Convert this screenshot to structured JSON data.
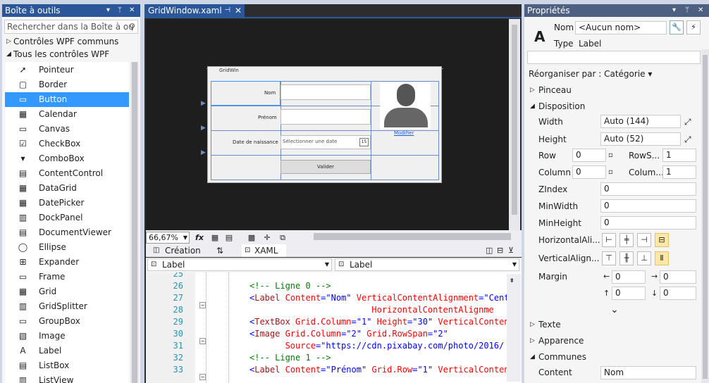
{
  "toolbox": {
    "title": "Boîte à outils",
    "search_placeholder": "Rechercher dans la Boîte à ou",
    "cat_common": "Contrôles WPF communs",
    "cat_all": "Tous les contrôles WPF",
    "items": [
      "Pointeur",
      "Border",
      "Button",
      "Calendar",
      "Canvas",
      "CheckBox",
      "ComboBox",
      "ContentControl",
      "DataGrid",
      "DatePicker",
      "DockPanel",
      "DocumentViewer",
      "Ellipse",
      "Expander",
      "Frame",
      "Grid",
      "GridSplitter",
      "GroupBox",
      "Image",
      "Label",
      "ListBox",
      "ListView"
    ],
    "selected": "Button"
  },
  "editor": {
    "tab_label": "GridWindow.xaml",
    "window_title": "GridWin",
    "col_widths": [
      "3*",
      "4*",
      "3*"
    ],
    "form": {
      "nom_label": "Nom",
      "prenom_label": "Prénom",
      "date_label": "Date de naissance",
      "date_placeholder": "Sélectionner une date",
      "calendar_day": "15",
      "modifier_link": "Modifier",
      "valider_button": "Valider"
    },
    "zoom": "66,67%",
    "fx_label": "fx",
    "creation_tab": "Création",
    "swap_icon": "⇅",
    "xaml_tab": "XAML",
    "left_combo": "Label",
    "right_combo": "Label",
    "code_lines": [
      {
        "n": "25",
        "html": ""
      },
      {
        "n": "26",
        "html": "<span class='cm'>&lt;!-- Ligne 0 --&gt;</span>"
      },
      {
        "n": "27",
        "html": "<span class='vl'>&lt;</span><span class='tg'>Label</span> <span class='at'>Content</span><span class='vl'>=\"Nom\"</span> <span class='at'>VerticalContentAlignment</span><span class='vl'>=\"Cente</span>"
      },
      {
        "n": "28",
        "html": "                        <span class='at'>HorizontalContentAlignme</span>"
      },
      {
        "n": "29",
        "html": "<span class='vl'>&lt;</span><span class='tg'>TextBox</span> <span class='at'>Grid.Column</span><span class='vl'>=\"1\"</span> <span class='at'>Height</span><span class='vl'>=\"30\"</span> <span class='at'>VerticalContent</span>"
      },
      {
        "n": "30",
        "html": "<span class='vl'>&lt;</span><span class='tg'>Image</span> <span class='at'>Grid.Column</span><span class='vl'>=\"2\"</span> <span class='at'>Grid.RowSpan</span><span class='vl'>=\"2\"</span>"
      },
      {
        "n": "31",
        "html": "       <span class='at'>Source</span><span class='vl'>=\"https://cdn.pixabay.com/photo/2016/</span>"
      },
      {
        "n": "32",
        "html": "<span class='cm'>&lt;!-- Ligne 1 --&gt;</span>"
      },
      {
        "n": "33",
        "html": "<span class='vl'>&lt;</span><span class='tg'>Label</span> <span class='at'>Content</span><span class='vl'>=\"Prénom\"</span> <span class='at'>Grid.Row</span><span class='vl'>=\"1\"</span> <span class='at'>VerticalContent</span>"
      }
    ]
  },
  "properties": {
    "title": "Propriétés",
    "name_label": "Nom",
    "name_value": "<Aucun nom>",
    "type_label": "Type",
    "type_value": "Label",
    "arrange_by": "Réorganiser par : Catégorie",
    "sections": {
      "pinceau": "Pinceau",
      "disposition": "Disposition",
      "texte": "Texte",
      "apparence": "Apparence",
      "communes": "Communes"
    },
    "width_label": "Width",
    "width_value": "Auto (144)",
    "height_label": "Height",
    "height_value": "Auto (52)",
    "row_label": "Row",
    "row_value": "0",
    "rowspan_label": "RowS...",
    "rowspan_value": "1",
    "column_label": "Column",
    "column_value": "0",
    "colspan_label": "Colum...",
    "colspan_value": "1",
    "zindex_label": "ZIndex",
    "zindex_value": "0",
    "minwidth_label": "MinWidth",
    "minwidth_value": "0",
    "minheight_label": "MinHeight",
    "minheight_value": "0",
    "halign_label": "HorizontalAli...",
    "valign_label": "VerticalAlign...",
    "margin_label": "Margin",
    "margin_values": [
      "0",
      "0",
      "0",
      "0"
    ],
    "content_label": "Content",
    "content_value": "Nom"
  }
}
